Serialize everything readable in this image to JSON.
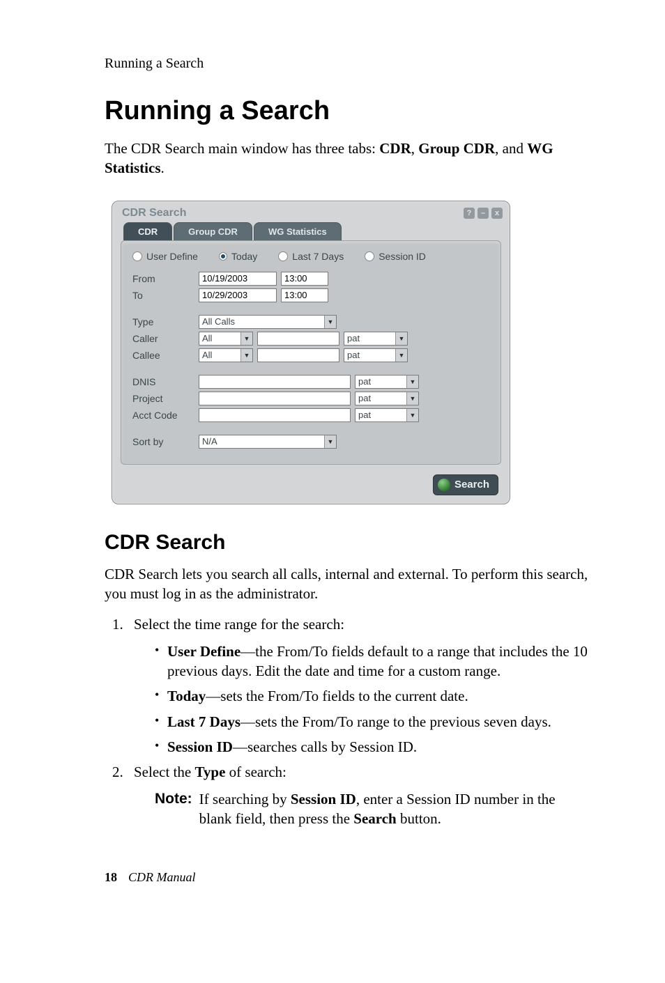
{
  "page": {
    "running_head": "Running a Search",
    "h1": "Running a Search",
    "intro_pre": "The CDR Search main window has three tabs: ",
    "intro_b1": "CDR",
    "intro_sep1": ", ",
    "intro_b2": "Group CDR",
    "intro_sep2": ", and ",
    "intro_b3": "WG Statistics",
    "intro_post": "."
  },
  "shot": {
    "title": "CDR Search",
    "tabs": {
      "cdr": "CDR",
      "group": "Group CDR",
      "wg": "WG Statistics"
    },
    "radios": {
      "user_define": "User Define",
      "today": "Today",
      "last7": "Last 7 Days",
      "session": "Session ID"
    },
    "labels": {
      "from": "From",
      "to": "To",
      "type": "Type",
      "caller": "Caller",
      "callee": "Callee",
      "dnis": "DNIS",
      "project": "Project",
      "acct": "Acct Code",
      "sortby": "Sort by"
    },
    "values": {
      "from_date": "10/19/2003",
      "from_time": "13:00",
      "to_date": "10/29/2003",
      "to_time": "13:00",
      "type": "All Calls",
      "caller_scope": "All",
      "caller_value": "",
      "caller_match": "pat",
      "callee_scope": "All",
      "callee_value": "",
      "callee_match": "pat",
      "dnis_value": "",
      "dnis_match": "pat",
      "project_value": "",
      "project_match": "pat",
      "acct_value": "",
      "acct_match": "pat",
      "sortby": "N/A"
    },
    "search_label": "Search"
  },
  "section": {
    "h2": "CDR Search",
    "p1": "CDR Search lets you search all calls, internal and external. To perform this search, you must log in as the administrator.",
    "step1": "Select the time range for the search:",
    "bullets": {
      "ud_b": "User Define",
      "ud_t": "—the From/To fields default to a range that includes the 10 previous days. Edit the date and time for a custom range.",
      "today_b": "Today",
      "today_t": "—sets the From/To fields to the current date.",
      "last7_b": "Last 7 Days",
      "last7_t": "—sets the From/To range to the previous seven days.",
      "sess_b": "Session ID",
      "sess_t": "—searches calls by Session ID."
    },
    "step2_pre": "Select the ",
    "step2_b": "Type",
    "step2_post": " of search:",
    "note_label": "Note:",
    "note_pre": "If searching by ",
    "note_b1": "Session ID",
    "note_mid": ", enter a Session ID number in the blank field, then press the ",
    "note_b2": "Search",
    "note_post": " button."
  },
  "footer": {
    "page": "18",
    "doc": "CDR Manual"
  }
}
